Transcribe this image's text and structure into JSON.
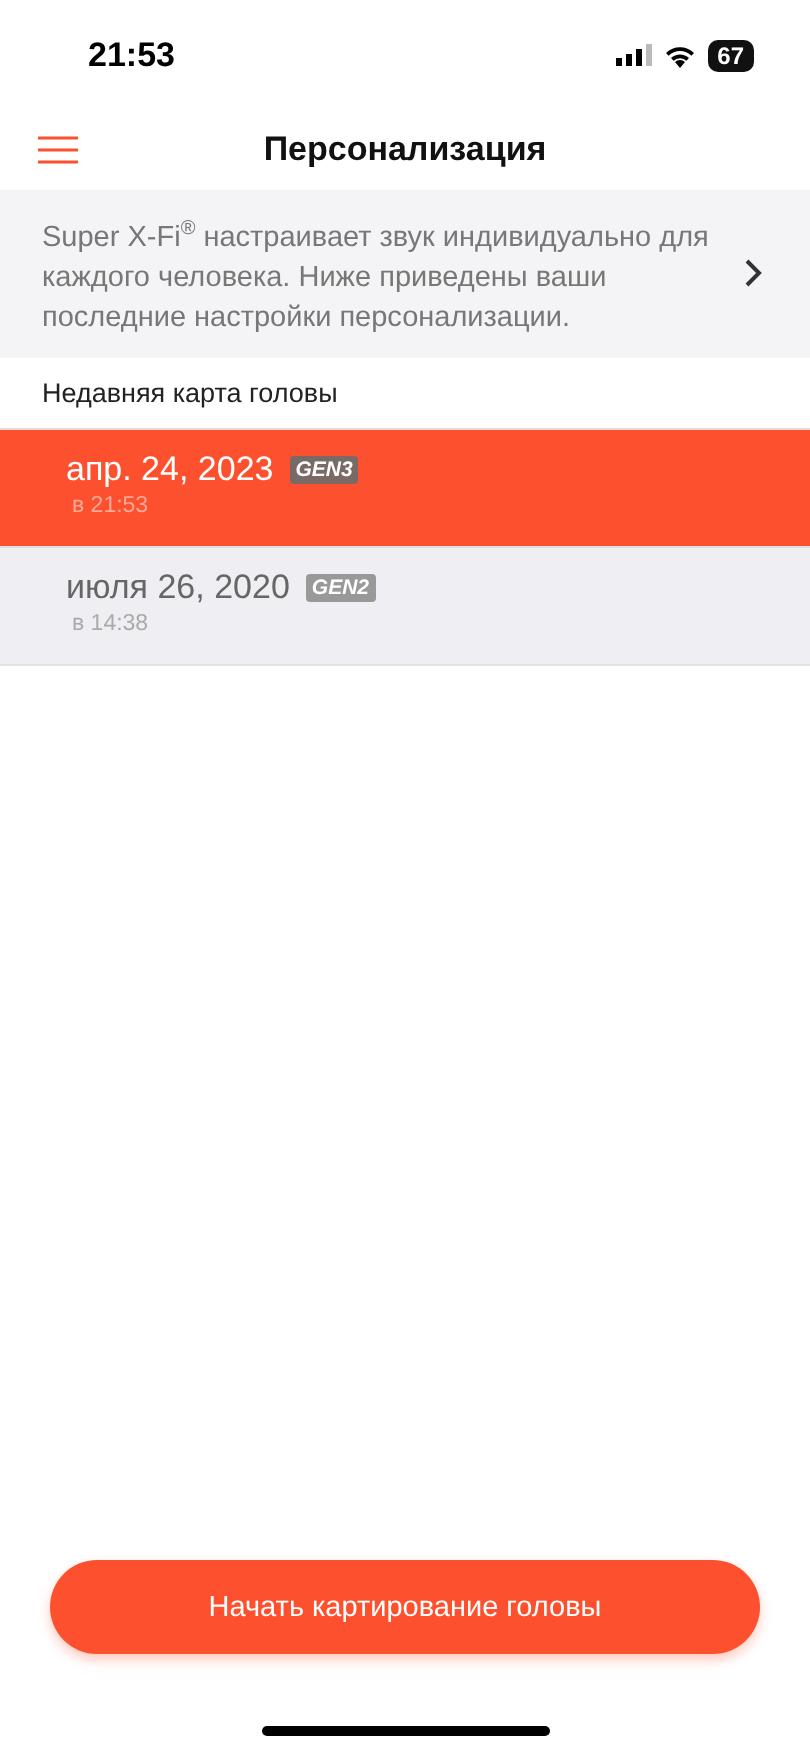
{
  "status_bar": {
    "time": "21:53",
    "battery": "67"
  },
  "header": {
    "title": "Персонализация"
  },
  "intro": {
    "text": "Super X-Fi$^{®}$ настраивает звук индивидуально для каждого человека. Ниже приведены ваши последние настройки персонализации."
  },
  "section": {
    "title": "Недавняя карта головы"
  },
  "head_maps": [
    {
      "date": "апр. 24, 2023",
      "badge": "GEN3",
      "time": "в 21:53",
      "selected": true
    },
    {
      "date": "июля 26, 2020",
      "badge": "GEN2",
      "time": "в 14:38",
      "selected": false
    }
  ],
  "action_button": {
    "label": "Начать картирование головы"
  }
}
